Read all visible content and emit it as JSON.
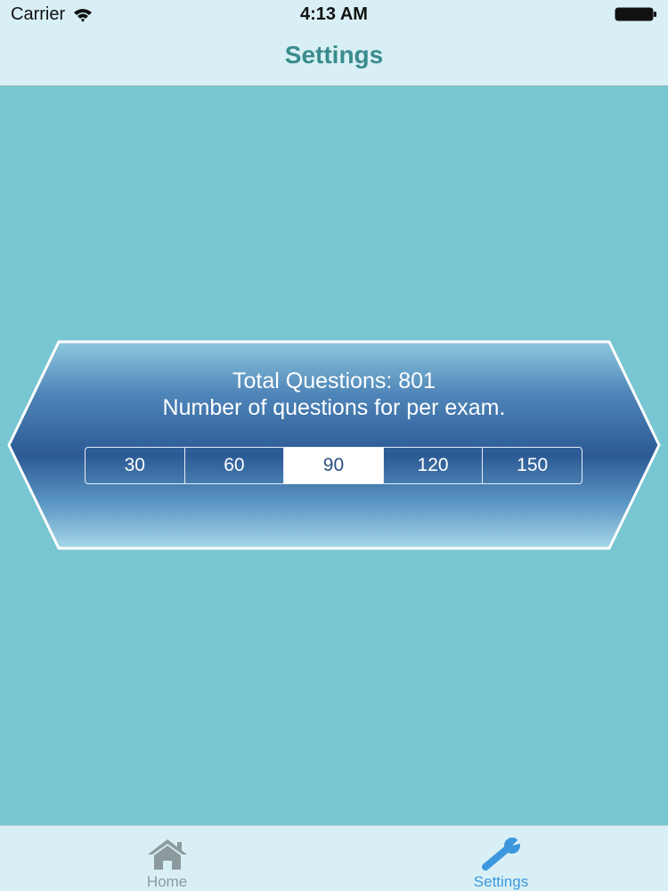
{
  "status_bar": {
    "carrier": "Carrier",
    "time": "4:13 AM",
    "icons": [
      "wifi-icon",
      "battery-icon"
    ]
  },
  "nav": {
    "title": "Settings"
  },
  "settings_panel": {
    "total_questions_text": "Total Questions: 801",
    "description": "Number of questions for per exam.",
    "question_options": [
      "30",
      "60",
      "90",
      "120",
      "150"
    ],
    "selected_option": "90"
  },
  "tab_bar": {
    "tabs": [
      {
        "label": "Home",
        "icon": "home-icon",
        "active": false
      },
      {
        "label": "Settings",
        "icon": "wrench-icon",
        "active": true
      }
    ]
  },
  "colors": {
    "background": "#78c6d2",
    "bars": "#d8f0f5",
    "title": "#3a8b8d",
    "panel_dark": "#2c5a94",
    "panel_light": "#8ec8dd",
    "active_tab": "#3c97dd",
    "inactive_tab": "#8d9a9d"
  }
}
